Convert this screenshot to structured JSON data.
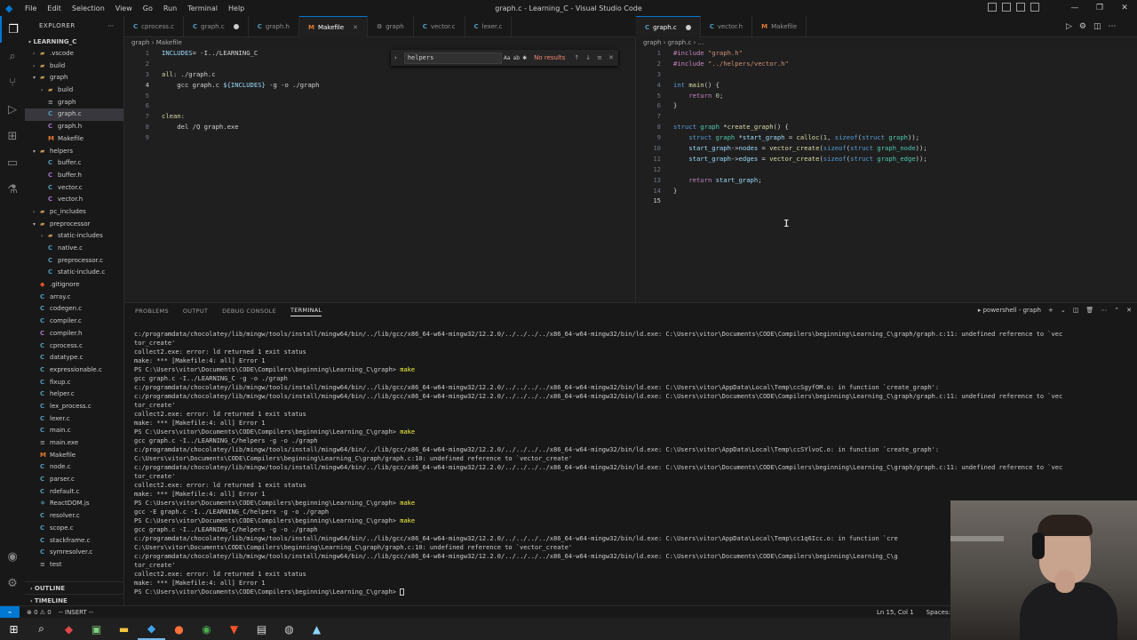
{
  "window": {
    "title": "graph.c - Learning_C - Visual Studio Code",
    "menu": [
      "File",
      "Edit",
      "Selection",
      "View",
      "Go",
      "Run",
      "Terminal",
      "Help"
    ],
    "controls": [
      "—",
      "❐",
      "✕"
    ]
  },
  "activity_bar": [
    "files-icon",
    "search-icon",
    "source-control-icon",
    "run-debug-icon",
    "extensions-icon",
    "remote-explorer-icon",
    "testing-icon"
  ],
  "sidebar": {
    "header": "EXPLORER",
    "root": "LEARNING_C",
    "tree": [
      {
        "label": ".vscode",
        "depth": 1,
        "kind": "folder",
        "open": false
      },
      {
        "label": "build",
        "depth": 1,
        "kind": "folder",
        "open": false
      },
      {
        "label": "graph",
        "depth": 1,
        "kind": "folder",
        "open": true
      },
      {
        "label": "build",
        "depth": 2,
        "kind": "folder",
        "open": false
      },
      {
        "label": "graph",
        "depth": 2,
        "kind": "file",
        "icon": "x"
      },
      {
        "label": "graph.c",
        "depth": 2,
        "kind": "file",
        "icon": "c",
        "selected": true
      },
      {
        "label": "graph.h",
        "depth": 2,
        "kind": "file",
        "icon": "h"
      },
      {
        "label": "Makefile",
        "depth": 2,
        "kind": "file",
        "icon": "m"
      },
      {
        "label": "helpers",
        "depth": 1,
        "kind": "folder",
        "open": true
      },
      {
        "label": "buffer.c",
        "depth": 2,
        "kind": "file",
        "icon": "c"
      },
      {
        "label": "buffer.h",
        "depth": 2,
        "kind": "file",
        "icon": "h"
      },
      {
        "label": "vector.c",
        "depth": 2,
        "kind": "file",
        "icon": "c"
      },
      {
        "label": "vector.h",
        "depth": 2,
        "kind": "file",
        "icon": "h"
      },
      {
        "label": "pc_includes",
        "depth": 1,
        "kind": "folder",
        "open": false
      },
      {
        "label": "preprocessor",
        "depth": 1,
        "kind": "folder",
        "open": true
      },
      {
        "label": "static-includes",
        "depth": 2,
        "kind": "folder",
        "open": false
      },
      {
        "label": "native.c",
        "depth": 2,
        "kind": "file",
        "icon": "c"
      },
      {
        "label": "preprocessor.c",
        "depth": 2,
        "kind": "file",
        "icon": "c"
      },
      {
        "label": "static-include.c",
        "depth": 2,
        "kind": "file",
        "icon": "c"
      },
      {
        "label": ".gitignore",
        "depth": 1,
        "kind": "file",
        "icon": "d"
      },
      {
        "label": "array.c",
        "depth": 1,
        "kind": "file",
        "icon": "c"
      },
      {
        "label": "codegen.c",
        "depth": 1,
        "kind": "file",
        "icon": "c"
      },
      {
        "label": "compiler.c",
        "depth": 1,
        "kind": "file",
        "icon": "c"
      },
      {
        "label": "compiler.h",
        "depth": 1,
        "kind": "file",
        "icon": "h"
      },
      {
        "label": "cprocess.c",
        "depth": 1,
        "kind": "file",
        "icon": "c"
      },
      {
        "label": "datatype.c",
        "depth": 1,
        "kind": "file",
        "icon": "c"
      },
      {
        "label": "expressionable.c",
        "depth": 1,
        "kind": "file",
        "icon": "c"
      },
      {
        "label": "fixup.c",
        "depth": 1,
        "kind": "file",
        "icon": "c"
      },
      {
        "label": "helper.c",
        "depth": 1,
        "kind": "file",
        "icon": "c"
      },
      {
        "label": "lex_process.c",
        "depth": 1,
        "kind": "file",
        "icon": "c"
      },
      {
        "label": "lexer.c",
        "depth": 1,
        "kind": "file",
        "icon": "c"
      },
      {
        "label": "main.c",
        "depth": 1,
        "kind": "file",
        "icon": "c"
      },
      {
        "label": "main.exe",
        "depth": 1,
        "kind": "file",
        "icon": "x"
      },
      {
        "label": "Makefile",
        "depth": 1,
        "kind": "file",
        "icon": "m"
      },
      {
        "label": "node.c",
        "depth": 1,
        "kind": "file",
        "icon": "c"
      },
      {
        "label": "parser.c",
        "depth": 1,
        "kind": "file",
        "icon": "c"
      },
      {
        "label": "rdefault.c",
        "depth": 1,
        "kind": "file",
        "icon": "c"
      },
      {
        "label": "ReactDOM.js",
        "depth": 1,
        "kind": "file",
        "icon": "j"
      },
      {
        "label": "resolver.c",
        "depth": 1,
        "kind": "file",
        "icon": "c"
      },
      {
        "label": "scope.c",
        "depth": 1,
        "kind": "file",
        "icon": "c"
      },
      {
        "label": "stackframe.c",
        "depth": 1,
        "kind": "file",
        "icon": "c"
      },
      {
        "label": "symresolver.c",
        "depth": 1,
        "kind": "file",
        "icon": "c"
      },
      {
        "label": "test",
        "depth": 1,
        "kind": "file",
        "icon": "x"
      }
    ],
    "sections": [
      "OUTLINE",
      "TIMELINE"
    ]
  },
  "left_group": {
    "tabs": [
      {
        "label": "cprocess.c",
        "icon": "C"
      },
      {
        "label": "graph.c",
        "icon": "C",
        "dirty": true
      },
      {
        "label": "graph.h",
        "icon": "C"
      },
      {
        "label": "Makefile",
        "icon": "M",
        "active": true,
        "close": "✕"
      },
      {
        "label": "graph",
        "icon": "⚙"
      },
      {
        "label": "vector.c",
        "icon": "C"
      },
      {
        "label": "lexer.c",
        "icon": "C"
      }
    ],
    "breadcrumb": [
      "graph",
      "Makefile"
    ],
    "find": {
      "value": "helpers",
      "status": "No results",
      "opts": [
        "Aa",
        "ab",
        "✱"
      ]
    },
    "lines": [
      {
        "n": "1",
        "html": "<span class='var'>INCLUDES</span><span class='tx'>= -I../LEARNING_C</span>"
      },
      {
        "n": "2",
        "html": ""
      },
      {
        "n": "3",
        "html": "<span class='fn'>all</span><span class='tx'>: ./graph.c</span>"
      },
      {
        "n": "4",
        "html": "<span class='tx'>    gcc graph.c </span><span class='var'>${INCLUDES}</span><span class='tx'> -g -o ./graph</span>",
        "current": true
      },
      {
        "n": "5",
        "html": ""
      },
      {
        "n": "6",
        "html": ""
      },
      {
        "n": "7",
        "html": "<span class='fn'>clean</span><span class='tx'>:</span>"
      },
      {
        "n": "8",
        "html": "<span class='tx'>    del /Q graph.exe</span>"
      },
      {
        "n": "9",
        "html": ""
      }
    ]
  },
  "right_group": {
    "tabs": [
      {
        "label": "graph.c",
        "icon": "C",
        "active": true,
        "dirty": true
      },
      {
        "label": "vector.h",
        "icon": "C"
      },
      {
        "label": "Makefile",
        "icon": "M"
      }
    ],
    "breadcrumb": [
      "graph",
      "graph.c",
      "..."
    ],
    "lines": [
      {
        "n": "1",
        "html": "<span class='pp'>#include</span> <span class='str'>\"graph.h\"</span>"
      },
      {
        "n": "2",
        "html": "<span class='pp'>#include</span> <span class='str'>\"../helpers/vector.h\"</span>"
      },
      {
        "n": "3",
        "html": ""
      },
      {
        "n": "4",
        "html": "<span class='kw'>int</span> <span class='fn'>main</span><span class='tx'>() {</span>"
      },
      {
        "n": "5",
        "html": "    <span class='pp'>return</span> <span class='num'>0</span><span class='tx'>;</span>"
      },
      {
        "n": "6",
        "html": "<span class='tx'>}</span>"
      },
      {
        "n": "7",
        "html": ""
      },
      {
        "n": "8",
        "html": "<span class='kw'>struct</span> <span class='ty'>graph</span> <span class='tx'>*</span><span class='fn'>create_graph</span><span class='tx'>() {</span>"
      },
      {
        "n": "9",
        "html": "    <span class='kw'>struct</span> <span class='ty'>graph</span> <span class='tx'>*</span><span class='var'>start_graph</span> <span class='tx'>= </span><span class='fn'>calloc</span><span class='tx'>(</span><span class='num'>1</span><span class='tx'>, </span><span class='kw'>sizeof</span><span class='tx'>(</span><span class='kw'>struct</span> <span class='ty'>graph</span><span class='tx'>));</span>"
      },
      {
        "n": "10",
        "html": "    <span class='var'>start_graph</span><span class='tx'>-></span><span class='var'>nodes</span> <span class='tx'>= </span><span class='fn'>vector_create</span><span class='tx'>(</span><span class='kw'>sizeof</span><span class='tx'>(</span><span class='kw'>struct</span> <span class='ty'>graph_node</span><span class='tx'>));</span>"
      },
      {
        "n": "11",
        "html": "    <span class='var'>start_graph</span><span class='tx'>-></span><span class='var'>edges</span> <span class='tx'>= </span><span class='fn'>vector_create</span><span class='tx'>(</span><span class='kw'>sizeof</span><span class='tx'>(</span><span class='kw'>struct</span> <span class='ty'>graph_edge</span><span class='tx'>));</span>"
      },
      {
        "n": "12",
        "html": ""
      },
      {
        "n": "13",
        "html": "    <span class='pp'>return</span> <span class='var'>start_graph</span><span class='tx'>;</span>"
      },
      {
        "n": "14",
        "html": "<span class='tx'>}</span>"
      },
      {
        "n": "15",
        "html": "",
        "current": true
      }
    ]
  },
  "panel": {
    "tabs": [
      "PROBLEMS",
      "OUTPUT",
      "DEBUG CONSOLE",
      "TERMINAL"
    ],
    "active_tab": "TERMINAL",
    "terminal_name": "powershell - graph",
    "terminal_lines": [
      {
        "t": "c:/programdata/chocolatey/lib/mingw/tools/install/mingw64/bin/../lib/gcc/x86_64-w64-mingw32/12.2.0/../../../../x86_64-w64-mingw32/bin/ld.exe: C:\\Users\\vitor\\Documents\\CODE\\Compilers\\beginning\\Learning_C\\graph/graph.c:11: undefined reference to `vec"
      },
      {
        "t": "tor_create'"
      },
      {
        "t": "collect2.exe: error: ld returned 1 exit status"
      },
      {
        "t": "make: *** [Makefile:4: all] Error 1"
      },
      {
        "t": "PS C:\\Users\\vitor\\Documents\\CODE\\Compilers\\beginning\\Learning_C\\graph> ",
        "cmd": "make",
        "mark": "err"
      },
      {
        "t": "gcc graph.c -I../LEARNING_C -g -o ./graph"
      },
      {
        "t": "c:/programdata/chocolatey/lib/mingw/tools/install/mingw64/bin/../lib/gcc/x86_64-w64-mingw32/12.2.0/../../../../x86_64-w64-mingw32/bin/ld.exe: C:\\Users\\vitor\\AppData\\Local\\Temp\\ccSgyfOM.o: in function `create_graph':"
      },
      {
        "t": "c:/programdata/chocolatey/lib/mingw/tools/install/mingw64/bin/../lib/gcc/x86_64-w64-mingw32/12.2.0/../../../../x86_64-w64-mingw32/bin/ld.exe: C:\\Users\\vitor\\Documents\\CODE\\Compilers\\beginning\\Learning_C\\graph/graph.c:11: undefined reference to `vec"
      },
      {
        "t": "tor_create'"
      },
      {
        "t": "collect2.exe: error: ld returned 1 exit status"
      },
      {
        "t": "make: *** [Makefile:4: all] Error 1"
      },
      {
        "t": "PS C:\\Users\\vitor\\Documents\\CODE\\Compilers\\beginning\\Learning_C\\graph> ",
        "cmd": "make",
        "mark": "err"
      },
      {
        "t": "gcc graph.c -I../LEARNING_C/helpers -g -o ./graph"
      },
      {
        "t": "c:/programdata/chocolatey/lib/mingw/tools/install/mingw64/bin/../lib/gcc/x86_64-w64-mingw32/12.2.0/../../../../x86_64-w64-mingw32/bin/ld.exe: C:\\Users\\vitor\\AppData\\Local\\Temp\\ccSYlvoC.o: in function `create_graph':"
      },
      {
        "t": "C:\\Users\\vitor\\Documents\\CODE\\Compilers\\beginning\\Learning_C\\graph/graph.c:10: undefined reference to `vector_create'"
      },
      {
        "t": "c:/programdata/chocolatey/lib/mingw/tools/install/mingw64/bin/../lib/gcc/x86_64-w64-mingw32/12.2.0/../../../../x86_64-w64-mingw32/bin/ld.exe: C:\\Users\\vitor\\Documents\\CODE\\Compilers\\beginning\\Learning_C\\graph/graph.c:11: undefined reference to `vec"
      },
      {
        "t": "tor_create'"
      },
      {
        "t": "collect2.exe: error: ld returned 1 exit status"
      },
      {
        "t": "make: *** [Makefile:4: all] Error 1"
      },
      {
        "t": "PS C:\\Users\\vitor\\Documents\\CODE\\Compilers\\beginning\\Learning_C\\graph> ",
        "cmd": "make",
        "mark": "err"
      },
      {
        "t": "gcc -E graph.c -I../LEARNING_C/helpers -g -o ./graph"
      },
      {
        "t": "PS C:\\Users\\vitor\\Documents\\CODE\\Compilers\\beginning\\Learning_C\\graph> ",
        "cmd": "make",
        "mark": "ok"
      },
      {
        "t": "gcc graph.c -I../LEARNING_C/helpers -g -o ./graph"
      },
      {
        "t": "c:/programdata/chocolatey/lib/mingw/tools/install/mingw64/bin/../lib/gcc/x86_64-w64-mingw32/12.2.0/../../../../x86_64-w64-mingw32/bin/ld.exe: C:\\Users\\vitor\\AppData\\Local\\Temp\\cc1q6Icc.o: in function `cre"
      },
      {
        "t": "C:\\Users\\vitor\\Documents\\CODE\\Compilers\\beginning\\Learning_C\\graph/graph.c:10: undefined reference to `vector_create'"
      },
      {
        "t": "c:/programdata/chocolatey/lib/mingw/tools/install/mingw64/bin/../lib/gcc/x86_64-w64-mingw32/12.2.0/../../../../x86_64-w64-mingw32/bin/ld.exe: C:\\Users\\vitor\\Documents\\CODE\\Compilers\\beginning\\Learning_C\\g"
      },
      {
        "t": "tor_create'"
      },
      {
        "t": "collect2.exe: error: ld returned 1 exit status"
      },
      {
        "t": "make: *** [Makefile:4: all] Error 1"
      },
      {
        "t": "PS C:\\Users\\vitor\\Documents\\CODE\\Compilers\\beginning\\Learning_C\\graph> ",
        "cmd": "",
        "mark": "err",
        "cursor": true
      }
    ]
  },
  "statusbar": {
    "remote": "⌁",
    "problems": "⊗ 0 ⚠ 0",
    "mode": "-- INSERT --",
    "position": "Ln 15, Col 1",
    "spaces": "Spaces:"
  },
  "taskbar": [
    "windows-icon",
    "search-icon",
    "app-icon",
    "terminal-icon",
    "files-icon",
    "vscode-icon",
    "firefox-icon",
    "chrome-icon",
    "brave-icon",
    "notepad-icon",
    "obs-icon",
    "app2-icon"
  ]
}
